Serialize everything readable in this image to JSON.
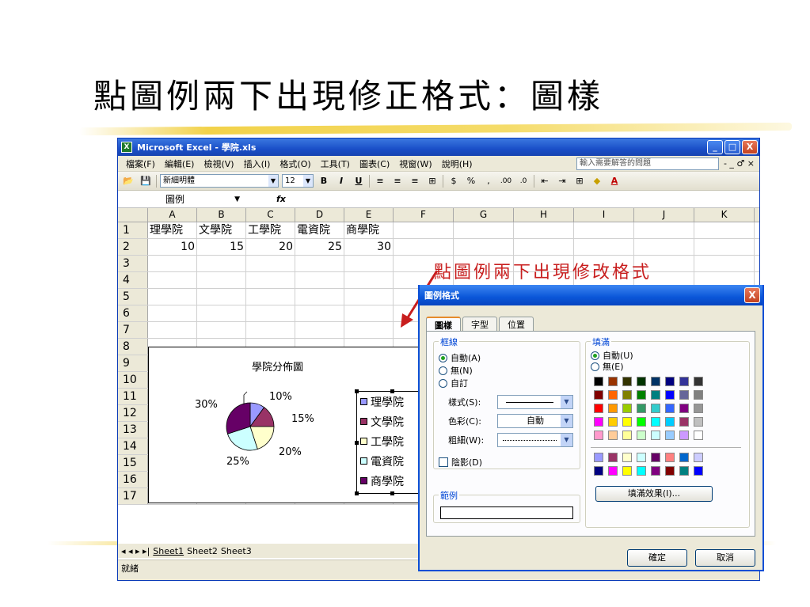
{
  "slide": {
    "title": "點圖例兩下出現修正格式：圖樣",
    "annotation": "點圖例兩下出現修改格式"
  },
  "window": {
    "title": "Microsoft Excel - 學院.xls",
    "buttons": {
      "minimize": "_",
      "maximize": "□",
      "close": "X"
    },
    "menu": [
      "檔案(F)",
      "編輯(E)",
      "檢視(V)",
      "插入(I)",
      "格式(O)",
      "工具(T)",
      "圖表(C)",
      "視窗(W)",
      "說明(H)"
    ],
    "help_search_placeholder": "輸入需要解答的問題",
    "menu_right_controls": "- _ ♂ ×",
    "toolbar": {
      "font_name": "新細明體",
      "font_size": "12",
      "bold": "B",
      "italic": "I",
      "underline": "U",
      "currency": "$",
      "percent": "%",
      "comma": ",",
      "inc_decimal": ".00",
      "dec_decimal": ".0",
      "font_color_label": "A"
    },
    "formula_bar": {
      "name_box": "圖例",
      "fx": "fx",
      "value": ""
    },
    "columns": [
      "A",
      "B",
      "C",
      "D",
      "E",
      "F",
      "G",
      "H",
      "I",
      "J",
      "K"
    ],
    "rows": [
      {
        "n": "1",
        "cells": [
          "理學院",
          "文學院",
          "工學院",
          "電資院",
          "商學院"
        ]
      },
      {
        "n": "2",
        "cells": [
          "10",
          "15",
          "20",
          "25",
          "30"
        ]
      },
      {
        "n": "3",
        "cells": []
      },
      {
        "n": "4",
        "cells": []
      },
      {
        "n": "5",
        "cells": []
      },
      {
        "n": "6",
        "cells": []
      },
      {
        "n": "7",
        "cells": []
      },
      {
        "n": "8",
        "cells": []
      },
      {
        "n": "9",
        "cells": []
      },
      {
        "n": "10",
        "cells": []
      },
      {
        "n": "11",
        "cells": []
      },
      {
        "n": "12",
        "cells": []
      },
      {
        "n": "13",
        "cells": []
      },
      {
        "n": "14",
        "cells": []
      },
      {
        "n": "15",
        "cells": []
      },
      {
        "n": "16",
        "cells": []
      },
      {
        "n": "17",
        "cells": []
      }
    ],
    "sheet_nav": "◂ ◂ ▸ ▸|",
    "sheets": [
      "Sheet1",
      "Sheet2",
      "Sheet3"
    ],
    "status": "就緒"
  },
  "chart_data": {
    "type": "pie",
    "title": "學院分佈圖",
    "categories": [
      "理學院",
      "文學院",
      "工學院",
      "電資院",
      "商學院"
    ],
    "values": [
      10,
      15,
      20,
      25,
      30
    ],
    "labels": [
      "10%",
      "15%",
      "20%",
      "25%",
      "30%"
    ],
    "colors": [
      "#9999ff",
      "#993366",
      "#ffffcc",
      "#ccffff",
      "#660066"
    ],
    "legend": "right"
  },
  "dialog": {
    "title": "圖例格式",
    "close": "X",
    "tabs": [
      "圖樣",
      "字型",
      "位置"
    ],
    "border": {
      "label": "框線",
      "options": [
        "自動(A)",
        "無(N)",
        "自訂"
      ],
      "selected": "自動(A)",
      "style_label": "樣式(S):",
      "color_label": "色彩(C):",
      "color_value": "自動",
      "weight_label": "粗細(W):",
      "shadow_label": "陰影(D)"
    },
    "fill": {
      "label": "填滿",
      "options": [
        "自動(U)",
        "無(E)"
      ],
      "selected": "自動(U)",
      "palette_main": [
        "#000000",
        "#993300",
        "#333300",
        "#003300",
        "#003366",
        "#000080",
        "#333399",
        "#333333",
        "#800000",
        "#ff6600",
        "#808000",
        "#008000",
        "#008080",
        "#0000ff",
        "#666699",
        "#808080",
        "#ff0000",
        "#ff9900",
        "#99cc00",
        "#339966",
        "#33cccc",
        "#3366ff",
        "#800080",
        "#969696",
        "#ff00ff",
        "#ffcc00",
        "#ffff00",
        "#00ff00",
        "#00ffff",
        "#00ccff",
        "#993366",
        "#c0c0c0",
        "#ff99cc",
        "#ffcc99",
        "#ffff99",
        "#ccffcc",
        "#ccffff",
        "#99ccff",
        "#cc99ff",
        "#ffffff"
      ],
      "palette_extra": [
        "#9999ff",
        "#993366",
        "#ffffcc",
        "#ccffff",
        "#660066",
        "#ff8080",
        "#0066cc",
        "#ccccff",
        "#000080",
        "#ff00ff",
        "#ffff00",
        "#00ffff",
        "#800080",
        "#800000",
        "#008080",
        "#0000ff"
      ],
      "fill_effects_button": "填滿效果(I)..."
    },
    "sample_label": "範例",
    "ok": "確定",
    "cancel": "取消"
  }
}
